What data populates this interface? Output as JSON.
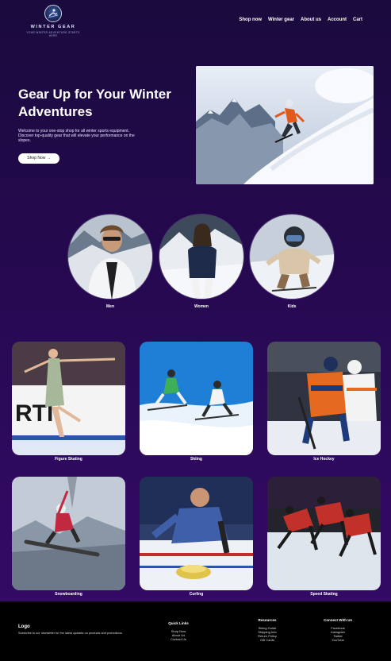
{
  "header": {
    "logo_name": "WINTER GEAR",
    "logo_tagline": "YOUR WINTER ADVENTURE STARTS HERE",
    "nav": [
      "Shop now",
      "Winter gear",
      "About us",
      "Account",
      "Cart"
    ]
  },
  "hero": {
    "title": "Gear Up for Your Winter Adventures",
    "description": "Welcome to your one-stop shop for all winter sports equipment. Discover top-quality gear that will elevate your performance on the slopes.",
    "button": "Shop Now →"
  },
  "audiences": [
    {
      "label": "Men"
    },
    {
      "label": "Women"
    },
    {
      "label": "Kids"
    }
  ],
  "sports": [
    {
      "label": "Figure Skating"
    },
    {
      "label": "Skiing"
    },
    {
      "label": "Ice Hockey"
    },
    {
      "label": "Snowboarding"
    },
    {
      "label": "Curling"
    },
    {
      "label": "Speed Skating"
    }
  ],
  "footer": {
    "logo": "Logo",
    "subscribe_text": "Subscribe to our newsletter for the latest updates on products and promotions.",
    "columns": [
      {
        "title": "Quick Links",
        "links": [
          "Shop Now",
          "About Us",
          "Contact Us"
        ]
      },
      {
        "title": "Resources",
        "links": [
          "Skiing Guide",
          "Shipping Info",
          "Return Policy",
          "Gift Cards"
        ]
      },
      {
        "title": "Connect With Us",
        "links": [
          "Facebook",
          "Instagram",
          "Twitter",
          "YouTube"
        ]
      }
    ]
  }
}
